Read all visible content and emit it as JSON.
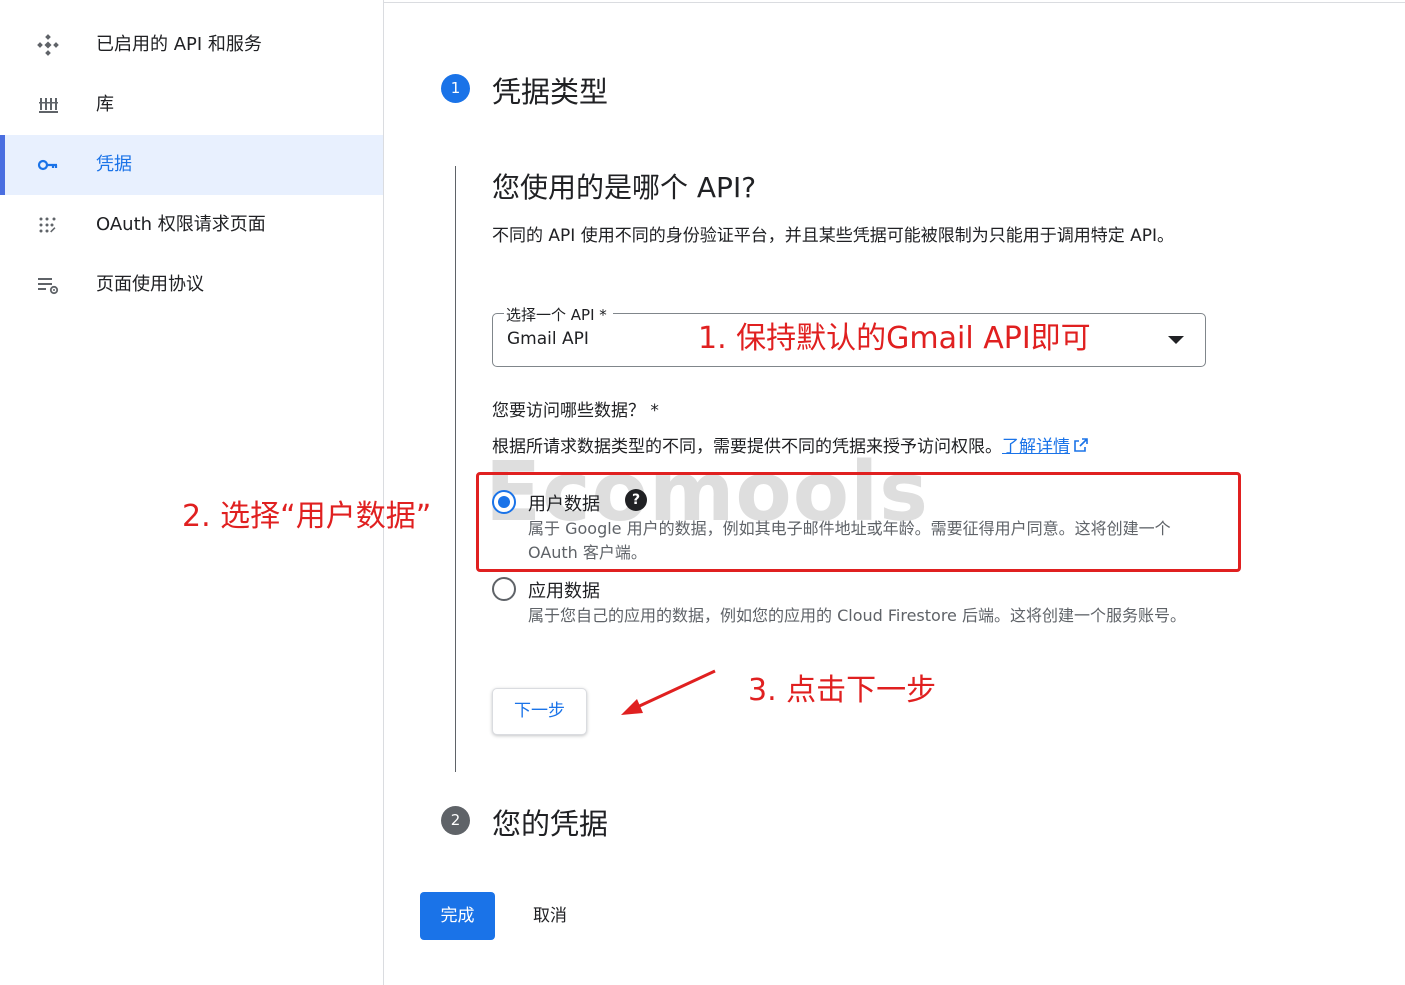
{
  "sidebar": {
    "items": [
      {
        "label": "已启用的 API 和服务",
        "icon": "api-services-icon"
      },
      {
        "label": "库",
        "icon": "library-icon"
      },
      {
        "label": "凭据",
        "icon": "key-icon",
        "active": true
      },
      {
        "label": "OAuth 权限请求页面",
        "icon": "oauth-consent-icon"
      },
      {
        "label": "页面使用协议",
        "icon": "page-agreement-icon"
      }
    ]
  },
  "steps": {
    "step1": {
      "number": "1",
      "title": "凭据类型"
    },
    "step2": {
      "number": "2",
      "title": "您的凭据"
    }
  },
  "api_section": {
    "heading": "您使用的是哪个 API?",
    "description": "不同的 API 使用不同的身份验证平台，并且某些凭据可能被限制为只能用于调用特定 API。",
    "select_label": "选择一个 API *",
    "select_value": "Gmail API"
  },
  "data_section": {
    "question": "您要访问哪些数据？ *",
    "description": "根据所请求数据类型的不同，需要提供不同的凭据来授予访问权限。",
    "learn_more": "了解详情",
    "options": [
      {
        "title": "用户数据",
        "description": "属于 Google 用户的数据，例如其电子邮件地址或年龄。需要征得用户同意。这将创建一个 OAuth 客户端。",
        "selected": true
      },
      {
        "title": "应用数据",
        "description": "属于您自己的应用的数据，例如您的应用的 Cloud Firestore 后端。这将创建一个服务账号。",
        "selected": false
      }
    ]
  },
  "buttons": {
    "next": "下一步",
    "done": "完成",
    "cancel": "取消"
  },
  "annotations": {
    "a1": "1. 保持默认的Gmail API即可",
    "a2": "2. 选择“用户数据”",
    "a3": "3. 点击下一步"
  },
  "watermark": "Ecomools",
  "colors": {
    "accent": "#1a73e8",
    "annotation": "#e02020",
    "active_bg": "#e8f0fe"
  }
}
